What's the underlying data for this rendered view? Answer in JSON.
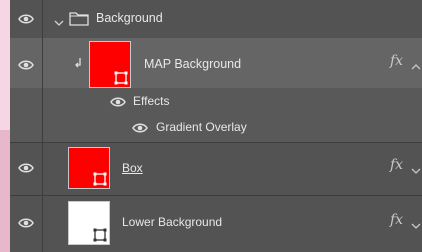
{
  "layers": {
    "group": {
      "name": "Background",
      "visible": true,
      "expanded": true
    },
    "map_background": {
      "name": "MAP Background",
      "clipped": true,
      "thumb_color": "#ff0000",
      "fx": "fx"
    },
    "effects": {
      "label": "Effects"
    },
    "gradient_overlay": {
      "label": "Gradient Overlay"
    },
    "box": {
      "name": "Box",
      "thumb_color": "#ff0000",
      "fx": "fx"
    },
    "lower_background": {
      "name": "Lower Background",
      "thumb_color": "#ffffff",
      "fx": "fx"
    }
  },
  "icons": {
    "visibility": "eye-icon",
    "expand": "chevron-down-icon",
    "folder": "folder-icon",
    "clip": "clipping-arrow-icon",
    "effects": "fx-icon"
  },
  "colors": {
    "panel_bg": "#535353",
    "selected_row": "#656565",
    "red_fill": "#ff0000"
  }
}
